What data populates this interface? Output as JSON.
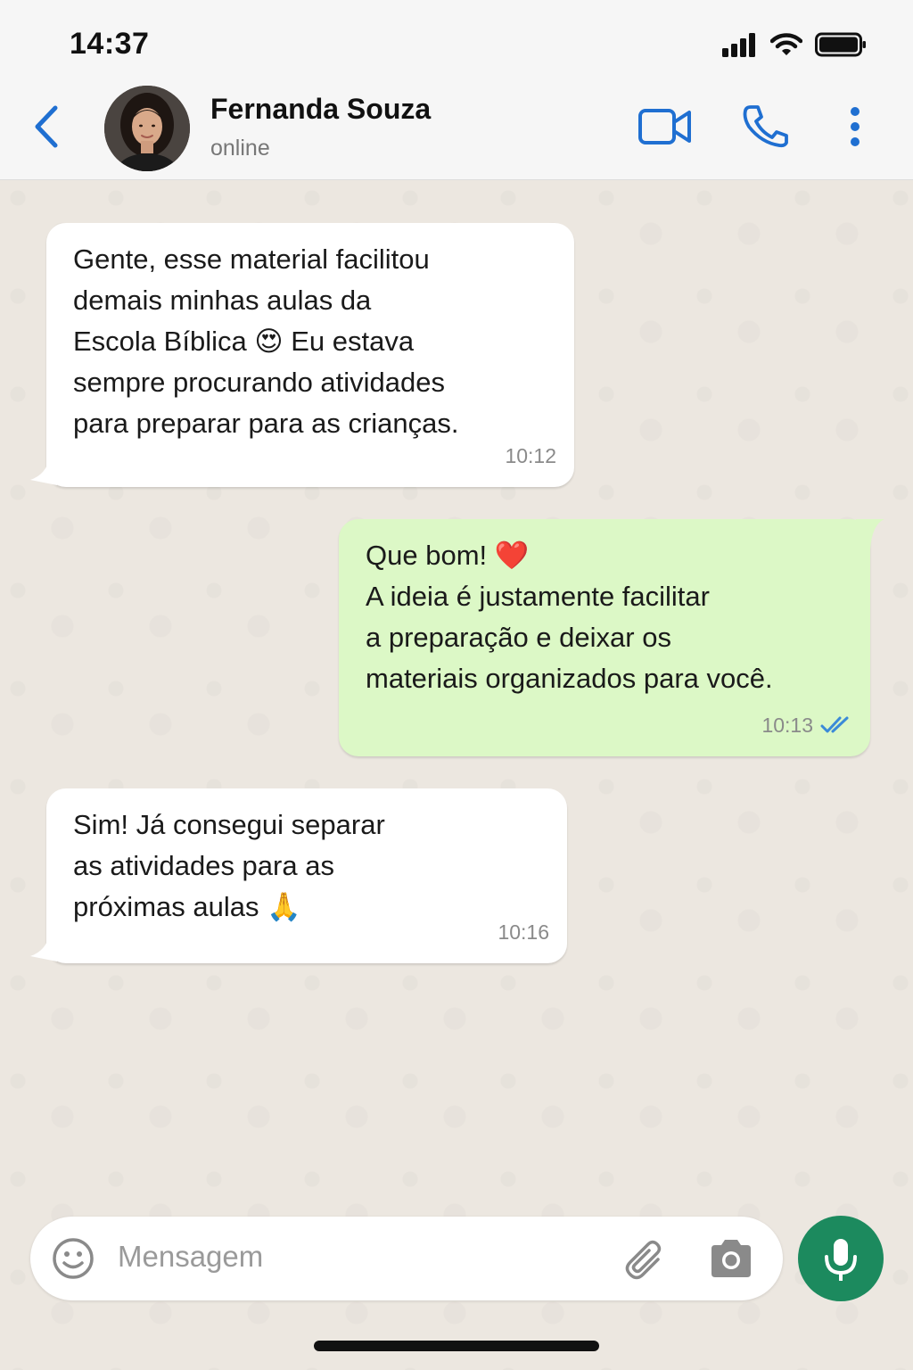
{
  "status_bar": {
    "time": "14:37"
  },
  "header": {
    "back_icon": "chevron-left-icon",
    "contact_name": "Fernanda Souza",
    "contact_status": "online",
    "accent_color": "#1f6fd1"
  },
  "messages": [
    {
      "direction": "incoming",
      "text": "Gente, esse material facilitou\ndemais minhas aulas da\nEscola Bíblica 😍  Eu estava\nsempre procurando atividades\npara preparar para as crianças.",
      "time": "10:12"
    },
    {
      "direction": "outgoing",
      "text": "Que bom! ❤️\nA ideia é justamente facilitar\na preparação e deixar os\nmateriais organizados para você.",
      "time": "10:13",
      "read_status": "double-check-read"
    },
    {
      "direction": "incoming",
      "text": "Sim! Já consegui separar\nas atividades para as\npróximas aulas 🙏",
      "time": "10:16"
    }
  ],
  "input": {
    "placeholder": "Mensagem"
  },
  "colors": {
    "outgoing_bubble": "#dcf8c6",
    "incoming_bubble": "#ffffff",
    "mic_button": "#1c8a5e",
    "read_ticks": "#3b8ad8"
  }
}
